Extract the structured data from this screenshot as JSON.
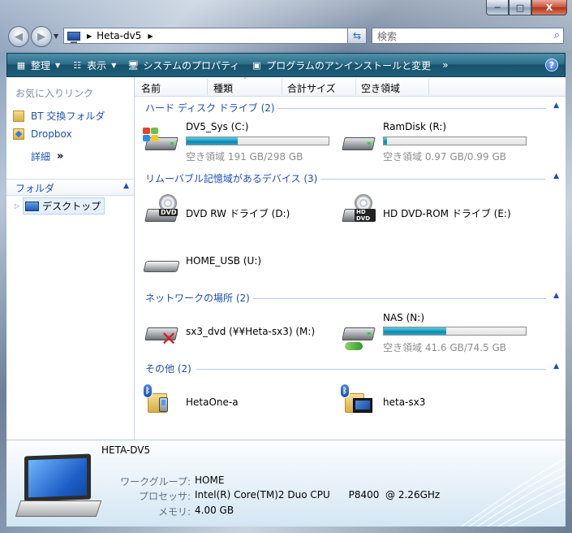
{
  "window": {
    "min_label": "─",
    "max_label": "□",
    "close_label": "X"
  },
  "address": {
    "crumb": "Heta-dv5",
    "sep": "▶",
    "dropdown": "▼"
  },
  "search": {
    "placeholder": "検索",
    "icon": "search-icon"
  },
  "toolbar": {
    "organize": "整理",
    "views": "表示",
    "system_properties": "システムのプロパティ",
    "uninstall": "プログラムのアンインストールと変更",
    "more": "»",
    "help": "?"
  },
  "nav": {
    "favorites_title": "お気に入りリンク",
    "favorites": [
      {
        "label": "BT 交換フォルダ",
        "icon": "folder-icon"
      },
      {
        "label": "Dropbox",
        "icon": "dropbox-icon"
      }
    ],
    "details_label": "詳細",
    "details_chevron": "»",
    "folders_label": "フォルダ",
    "tree_item": "デスクトップ"
  },
  "columns": [
    "名前",
    "種類",
    "合計サイズ",
    "空き領域"
  ],
  "groups": {
    "hdd": {
      "title": "ハード ディスク ドライブ (2)"
    },
    "removable": {
      "title": "リムーバブル記憶域があるデバイス (3)"
    },
    "network": {
      "title": "ネットワークの場所 (2)"
    },
    "other": {
      "title": "その他 (2)"
    }
  },
  "drives": {
    "c": {
      "name": "DV5_Sys (C:)",
      "free": "空き領域 191 GB/298 GB",
      "used_fraction": 0.36
    },
    "r": {
      "name": "RamDisk (R:)",
      "free": "空き領域 0.97 GB/0.99 GB",
      "used_fraction": 0.02
    },
    "d": {
      "name": "DVD RW ドライブ (D:)",
      "badge": "DVD"
    },
    "e": {
      "name": "HD DVD-ROM ドライブ (E:)",
      "badge": "HD DVD"
    },
    "u": {
      "name": "HOME_USB (U:)"
    },
    "m": {
      "name": "sx3_dvd (¥¥Heta-sx3) (M:)"
    },
    "n": {
      "name": "NAS (N:)",
      "free": "空き領域 41.6 GB/74.5 GB",
      "used_fraction": 0.44
    }
  },
  "other_items": [
    {
      "name": "HetaOne-a"
    },
    {
      "name": "heta-sx3"
    }
  ],
  "details": {
    "computer_name": "HETA-DV5",
    "workgroup_label": "ワークグループ:",
    "workgroup": "HOME",
    "processor_label": "プロセッサ:",
    "processor": "Intel(R) Core(TM)2 Duo CPU      P8400  @ 2.26GHz",
    "memory_label": "メモリ:",
    "memory": "4.00 GB"
  },
  "colors": {
    "link": "#1c4fb0",
    "toolbar": "#1e5f7b",
    "bar_fill": "#1ea2c6"
  }
}
